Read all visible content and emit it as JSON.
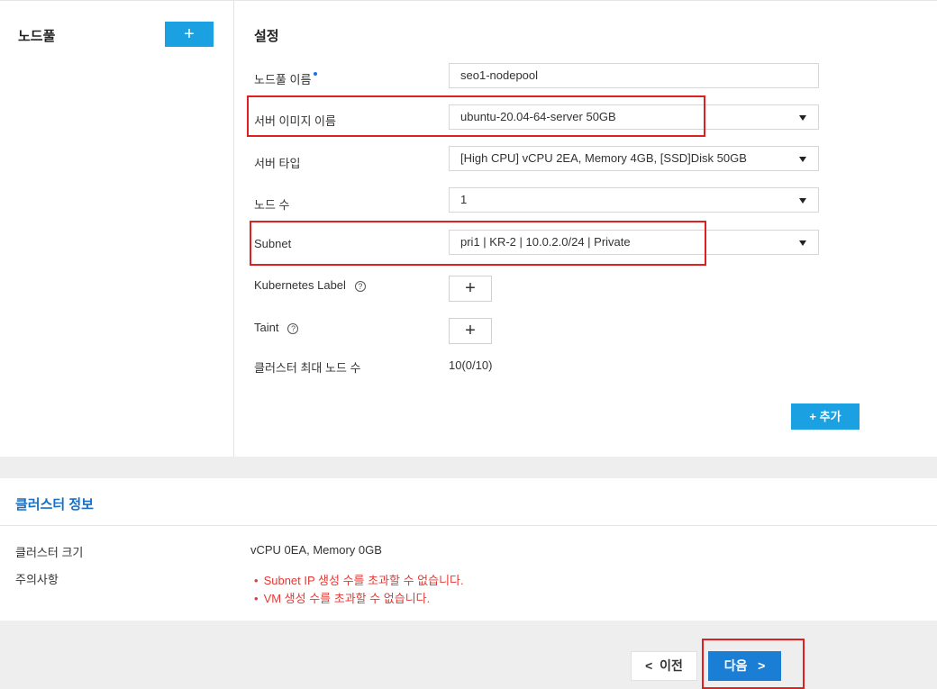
{
  "nodepool_panel": {
    "title": "노드풀",
    "add_icon": "+"
  },
  "settings": {
    "title": "설정",
    "fields": {
      "nodepool_name": {
        "label": "노드풀 이름",
        "value": "seo1-nodepool"
      },
      "server_image": {
        "label": "서버 이미지 이름",
        "value": "ubuntu-20.04-64-server 50GB"
      },
      "server_type": {
        "label": "서버 타입",
        "value": "[High CPU] vCPU 2EA, Memory 4GB, [SSD]Disk 50GB"
      },
      "node_count": {
        "label": "노드 수",
        "value": "1"
      },
      "subnet": {
        "label": "Subnet",
        "value": "pri1 | KR-2 | 10.0.2.0/24 | Private"
      },
      "k8s_label": {
        "label": "Kubernetes Label",
        "help": "?",
        "add_icon": "+"
      },
      "taint": {
        "label": "Taint",
        "help": "?",
        "add_icon": "+"
      },
      "max_nodes": {
        "label": "클러스터 최대 노드 수",
        "value": "10(0/10)"
      }
    },
    "add_button": {
      "icon": "+",
      "label": "추가"
    }
  },
  "cluster_info": {
    "title": "클러스터 정보",
    "size_label": "클러스터 크기",
    "size_value": "vCPU 0EA, Memory 0GB",
    "notes_label": "주의사항",
    "warnings": [
      "Subnet IP 생성 수를 초과할 수 없습니다.",
      "VM 생성 수를 초과할 수 없습니다."
    ]
  },
  "footer": {
    "prev_label": "이전",
    "next_label": "다음",
    "prev_icon": "<",
    "next_icon": ">"
  },
  "colors": {
    "accent": "#1ba1e2",
    "primary": "#1a7fd4",
    "warning": "#e53935",
    "highlight": "#e02020"
  }
}
